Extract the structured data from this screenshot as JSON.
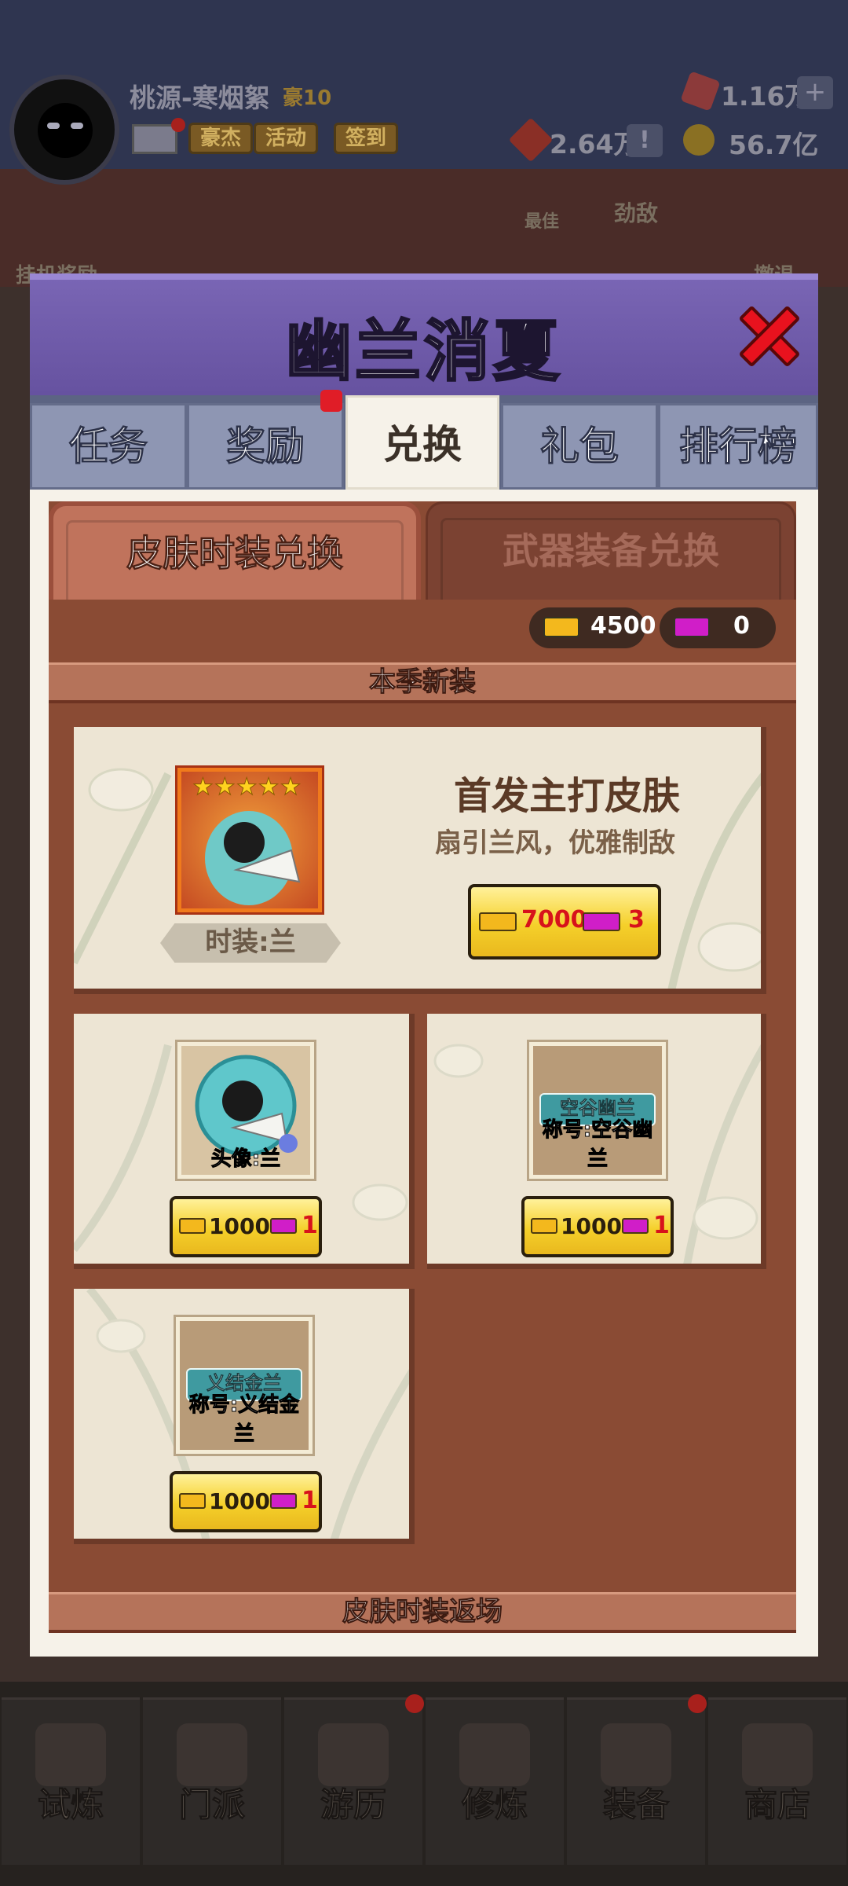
{
  "background": {
    "player": {
      "name": "桃源-寒烟絮",
      "rank": "豪10"
    },
    "chips": [
      "豪杰",
      "活动",
      "签到"
    ],
    "resources": {
      "gems": "1.16万",
      "plus": "+",
      "tokens": "2.64万",
      "notice": "!",
      "coins": "56.7亿"
    },
    "side_labels": {
      "afk_reward": "挂机奖励",
      "best": "最佳",
      "rival": "劲敌",
      "retreat": "撤退"
    },
    "bottom_nav": [
      "试炼",
      "门派",
      "游历",
      "修炼",
      "装备",
      "商店"
    ]
  },
  "modal": {
    "title": "幽兰消夏",
    "tabs": [
      {
        "label": "任务"
      },
      {
        "label": "奖励"
      },
      {
        "label": "兑换"
      },
      {
        "label": "礼包"
      },
      {
        "label": "排行榜"
      }
    ],
    "subtabs": {
      "skin": "皮肤时装兑换",
      "weapon": "武器装备兑换"
    },
    "currencies": {
      "gold_ticket": "4500",
      "purple_ticket": "0"
    },
    "section_new": "本季新装",
    "featured": {
      "title": "首发主打皮肤",
      "subtitle": "扇引兰风，优雅制敌",
      "stars": "★★★★★",
      "item_name": "时装:兰",
      "price_gold": "7000",
      "price_purple": "3"
    },
    "items": [
      {
        "label": "头像:兰",
        "banner": "",
        "price_gold": "1000",
        "price_purple": "1"
      },
      {
        "label": "称号:空谷幽兰",
        "banner": "空谷幽兰",
        "price_gold": "1000",
        "price_purple": "1"
      },
      {
        "label": "称号:义结金兰",
        "banner": "义结金兰",
        "price_gold": "1000",
        "price_purple": "1"
      }
    ],
    "section_return": "皮肤时装返场"
  },
  "colors": {
    "header_purple": "#6652a0",
    "close_red": "#e8121e",
    "panel_brown": "#8a4b34",
    "price_yellow": "#f5d02a",
    "ticket_gold": "#f3b81d",
    "ticket_purple": "#d01ec8"
  }
}
